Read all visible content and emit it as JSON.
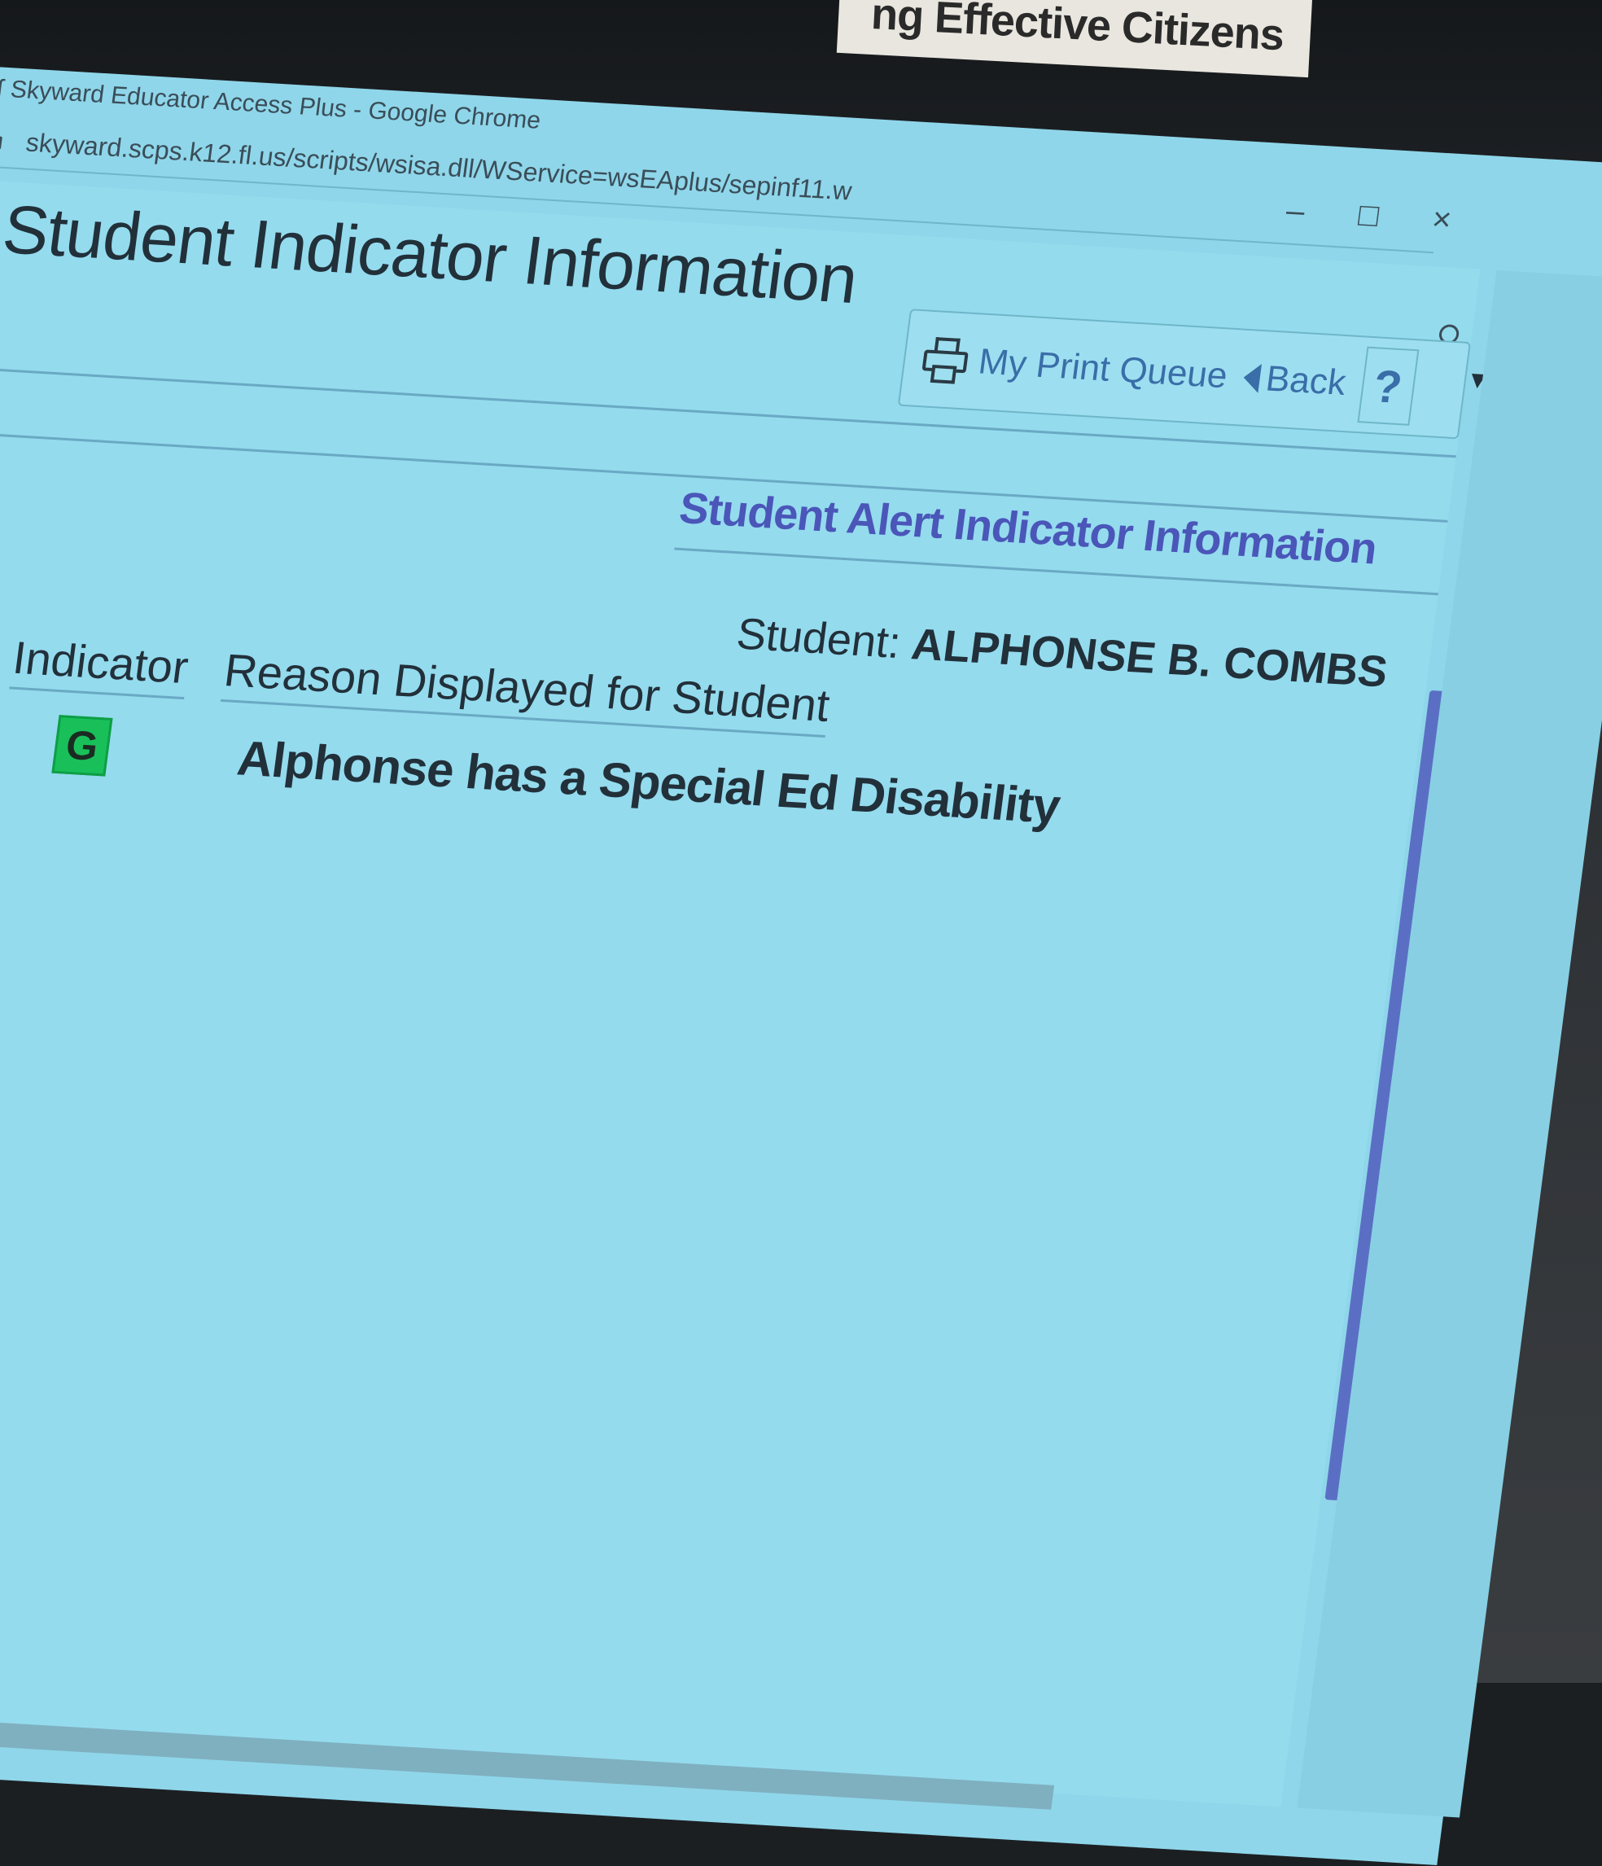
{
  "monitor_label": "ng Effective Citizens",
  "browser": {
    "window_title": "Skyward Educator Access Plus - Google Chrome",
    "url": "skyward.scps.k12.fl.us/scripts/wsisa.dll/WService=wsEAplus/sepinf11.w",
    "controls": {
      "minimize": "–",
      "maximize": "□",
      "close": "×"
    }
  },
  "page": {
    "title": "Student Indicator Information",
    "toolbar": {
      "print_queue_label": "My Print Queue",
      "back_label": "Back",
      "help_label": "?"
    },
    "section_title": "Student Alert Indicator Information",
    "student_label": "Student:",
    "student_name": "ALPHONSE B. COMBS",
    "table": {
      "headers": [
        "Indicator",
        "Reason Displayed for Student"
      ],
      "rows": [
        {
          "indicator": "G",
          "reason": "Alphonse has a Special Ed Disability"
        }
      ]
    }
  },
  "colors": {
    "screen_bg": "#94dbee",
    "title_text": "#22303a",
    "link_blue": "#3a6ea8",
    "section_title": "#4a56b8",
    "indicator_badge": "#19c05a"
  }
}
